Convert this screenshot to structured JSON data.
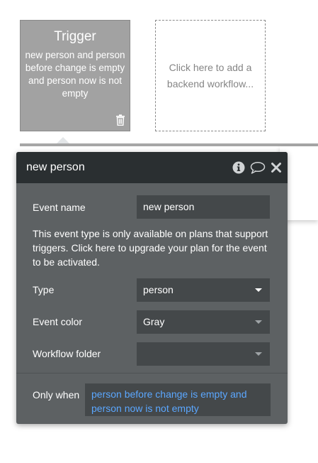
{
  "trigger_card": {
    "title": "Trigger",
    "description": "new person and person before change is empty and person now is not empty"
  },
  "add_workflow": {
    "label": "Click here to add a backend workflow..."
  },
  "panel": {
    "title": "new person",
    "icons": [
      "info-icon",
      "comment-icon",
      "close-icon"
    ],
    "event_name": {
      "label": "Event name",
      "value": "new person"
    },
    "notice": "This event type is only available on plans that support triggers. Click here to upgrade your plan for the event to be activated.",
    "type": {
      "label": "Type",
      "value": "person"
    },
    "event_color": {
      "label": "Event color",
      "value": "Gray"
    },
    "workflow_folder": {
      "label": "Workflow folder",
      "value": ""
    },
    "only_when": {
      "label": "Only when",
      "condition": "person before change is empty and person now is not empty"
    }
  },
  "colors": {
    "trigger_card_bg": "#a2a2a2",
    "panel_bg": "#5d6163",
    "panel_header_bg": "#2a2f31",
    "field_bg": "#44484a",
    "expression_text": "#5ba7ff"
  }
}
